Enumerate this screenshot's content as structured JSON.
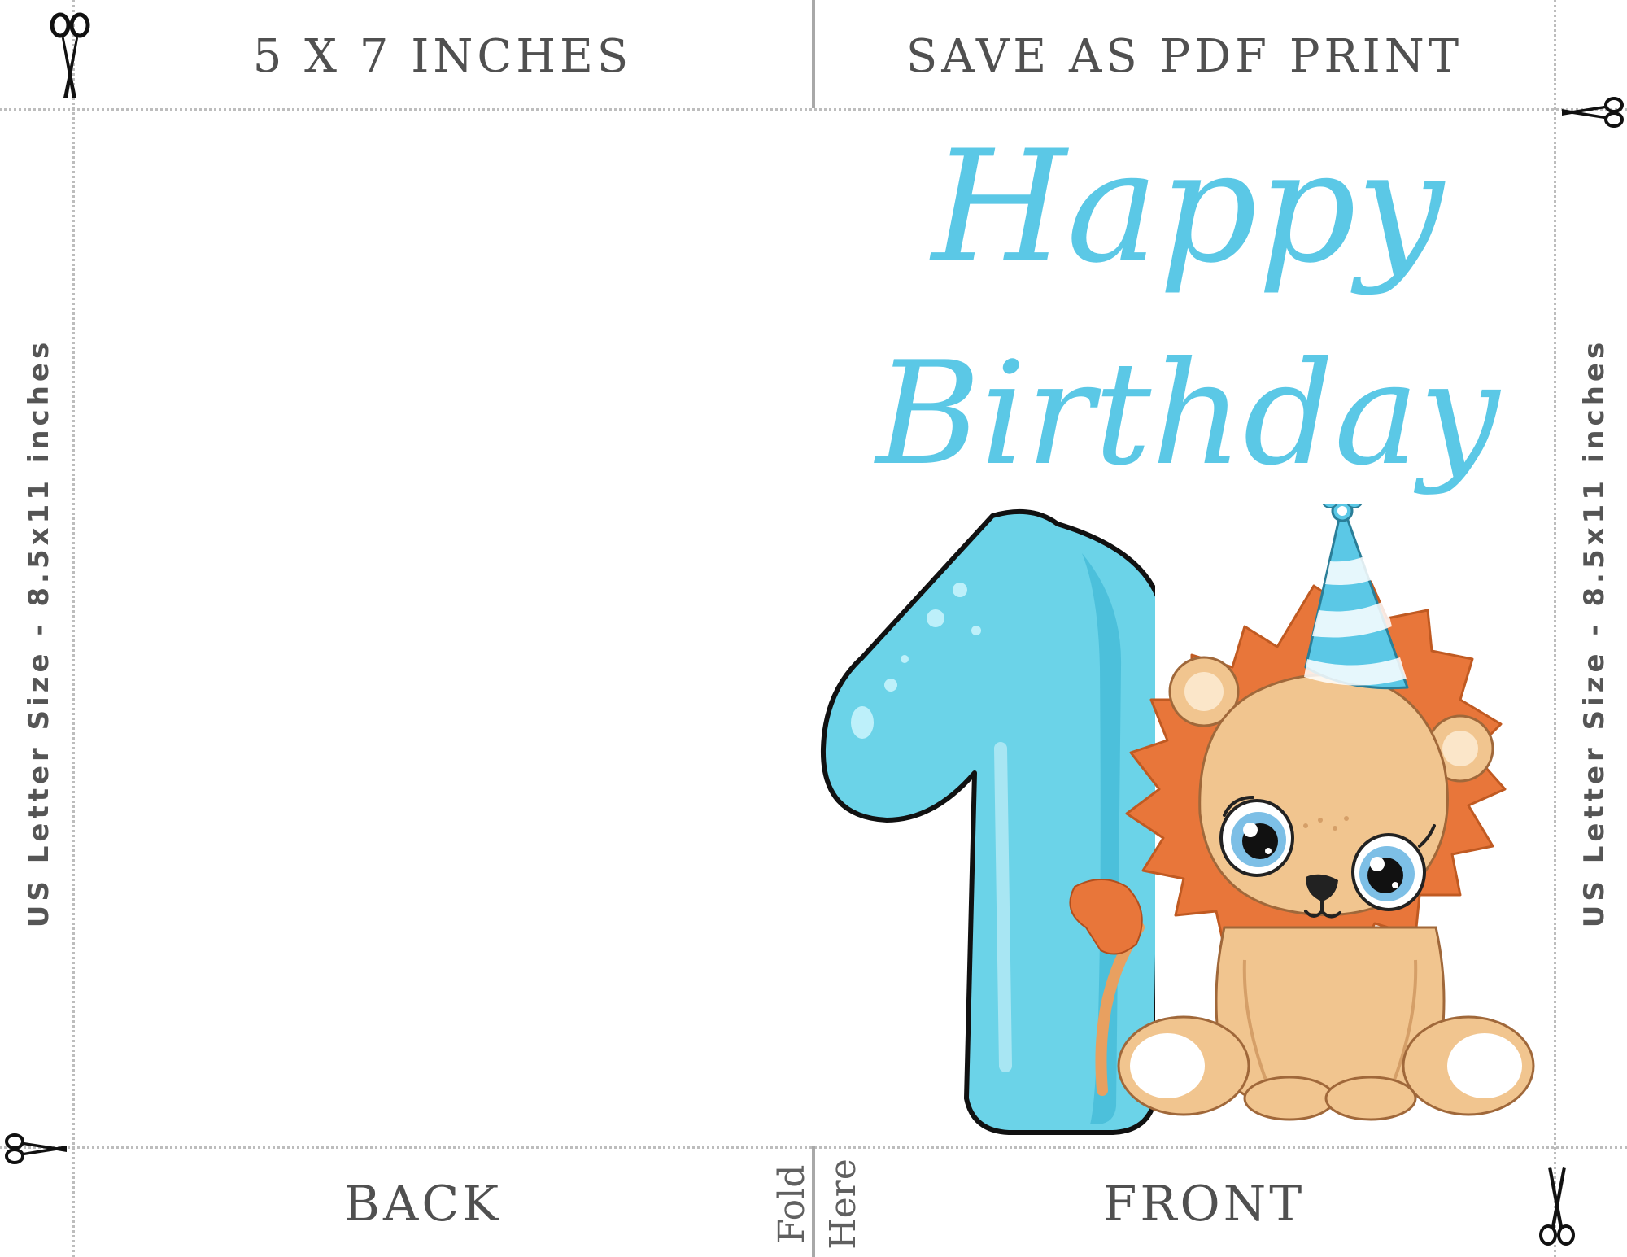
{
  "header": {
    "size_label": "5 X 7 INCHES",
    "save_label": "SAVE AS PDF PRINT"
  },
  "side_labels": {
    "left": "US Letter Size - 8.5x11 inches",
    "right": "US Letter Size - 8.5x11 inches"
  },
  "card_front": {
    "line1": "Happy",
    "line2": "Birthday",
    "age_numeral": "1",
    "illustration": "baby-lion-with-party-hat",
    "colors": {
      "headline": "#5bc8e6",
      "numeral": "#6bd3e8",
      "lion_mane": "#e8763a",
      "lion_fur": "#f1c58f",
      "hat": "#5bc8e6"
    }
  },
  "footer": {
    "back_label": "BACK",
    "front_label": "FRONT",
    "fold_word_1": "Fold",
    "fold_word_2": "Here"
  },
  "icons": [
    "scissors-icon"
  ],
  "guide_color": "#bdbdbd"
}
